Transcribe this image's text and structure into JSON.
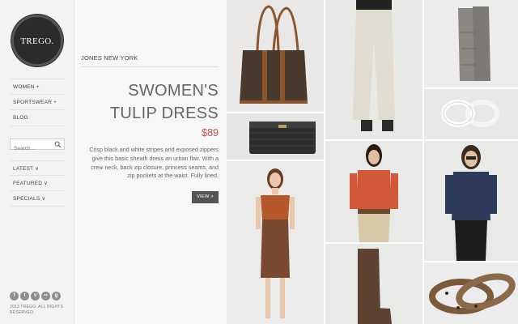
{
  "logo": {
    "text": "TREGO."
  },
  "nav_primary": [
    {
      "label": "WOMEN +"
    },
    {
      "label": "SPORTSWEAR +"
    },
    {
      "label": "BLOG"
    }
  ],
  "search": {
    "placeholder": "Search...",
    "icon": "search-icon"
  },
  "nav_secondary": [
    {
      "label": "LATEST ∨"
    },
    {
      "label": "FEATURED ∨"
    },
    {
      "label": "SPECIALS ∨"
    }
  ],
  "social_icons": [
    "facebook-icon",
    "twitter-icon",
    "vimeo-icon",
    "flickr-icon",
    "googleplus-icon"
  ],
  "copyright": "2013 TREGO. ALL RIGHTS RESERVED.",
  "product": {
    "brand": "JONES NEW YORK",
    "title_line1": "SWOMEN'S",
    "title_line2": "TULIP DRESS",
    "price": "$89",
    "description": "Crisp black and white stripes and exposed zippers give this basic sheath dress an urban flair. With a crew neck, back zip closure, princess seams, and zip pockets at the waist. Fully lined.",
    "view_label": "VIEW >"
  },
  "colors": {
    "accent": "#c0533c",
    "sidebar_bg": "#f3f3f3",
    "button": "#555555"
  },
  "grid_items": [
    "tote-bag",
    "white-pants",
    "knit-gloves",
    "croc-wallet",
    "rope-bracelet",
    "rust-top-skirt-model",
    "orange-blouse-model",
    "navy-shirt-model",
    "brown-boot",
    "leopard-bangles"
  ]
}
